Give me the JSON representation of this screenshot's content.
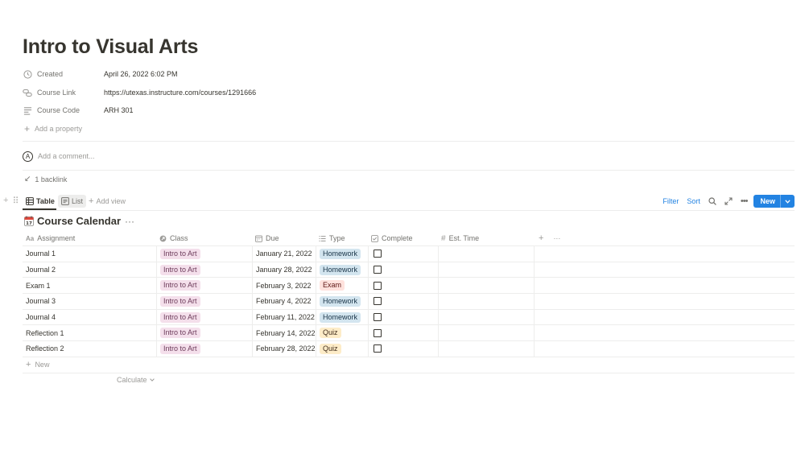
{
  "page": {
    "title": "Intro to Visual Arts"
  },
  "properties": [
    {
      "key": "Created",
      "value": "April 26, 2022 6:02 PM",
      "icon": "clock-icon"
    },
    {
      "key": "Course Link",
      "value": "https://utexas.instructure.com/courses/1291666",
      "icon": "link-icon"
    },
    {
      "key": "Course Code",
      "value": "ARH 301",
      "icon": "text-lines-icon"
    }
  ],
  "add_property_label": "Add a property",
  "comment": {
    "avatar_letter": "A",
    "placeholder": "Add a comment..."
  },
  "backlink_label": "1 backlink",
  "views": {
    "tabs": [
      {
        "label": "Table",
        "icon": "table-icon",
        "active": true
      },
      {
        "label": "List",
        "icon": "list-icon",
        "active": false
      }
    ],
    "add_view_label": "Add view"
  },
  "toolbar": {
    "filter_label": "Filter",
    "sort_label": "Sort",
    "new_label": "New"
  },
  "database": {
    "title": "Course Calendar",
    "icon": "calendar-icon",
    "columns": [
      {
        "label": "Assignment",
        "icon": "text-icon"
      },
      {
        "label": "Class",
        "icon": "relation-icon"
      },
      {
        "label": "Due",
        "icon": "date-icon"
      },
      {
        "label": "Type",
        "icon": "select-list-icon"
      },
      {
        "label": "Complete",
        "icon": "checkbox-icon"
      },
      {
        "label": "Est. Time",
        "icon": "hash-icon"
      }
    ],
    "rows": [
      {
        "assignment": "Journal 1",
        "class": "Intro to Art",
        "due": "January 21, 2022",
        "type": "Homework",
        "complete": false
      },
      {
        "assignment": "Journal 2",
        "class": "Intro to Art",
        "due": "January 28, 2022",
        "type": "Homework",
        "complete": false
      },
      {
        "assignment": "Exam 1",
        "class": "Intro to Art",
        "due": "February 3, 2022",
        "type": "Exam",
        "complete": false
      },
      {
        "assignment": "Journal 3",
        "class": "Intro to Art",
        "due": "February 4, 2022",
        "type": "Homework",
        "complete": false
      },
      {
        "assignment": "Journal 4",
        "class": "Intro to Art",
        "due": "February 11, 2022",
        "type": "Homework",
        "complete": false
      },
      {
        "assignment": "Reflection 1",
        "class": "Intro to Art",
        "due": "February 14, 2022",
        "type": "Quiz",
        "complete": false
      },
      {
        "assignment": "Reflection 2",
        "class": "Intro to Art",
        "due": "February 28, 2022",
        "type": "Quiz",
        "complete": false
      }
    ],
    "new_row_label": "New",
    "calculate_label": "Calculate"
  },
  "colors": {
    "accent": "#2383e2",
    "class_tag_bg": "#f4dfeb",
    "class_tag_fg": "#6c3b5a",
    "homework_bg": "#d3e5ef",
    "homework_fg": "#183347",
    "exam_bg": "#ffe2dd",
    "exam_fg": "#5d1715",
    "quiz_bg": "#fdecc8",
    "quiz_fg": "#402c1b"
  }
}
